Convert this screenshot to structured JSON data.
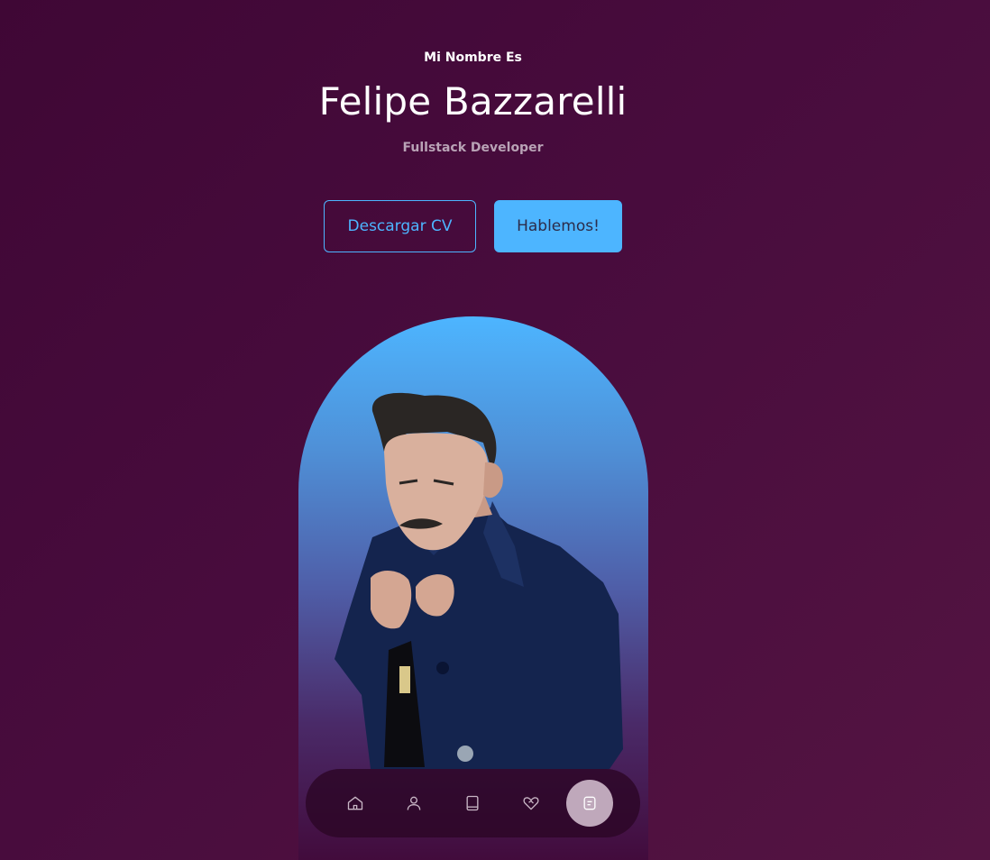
{
  "hero": {
    "greeting": "Mi Nombre Es",
    "name": "Felipe Bazzarelli",
    "role": "Fullstack Developer"
  },
  "cta": {
    "download_cv_label": "Descargar CV",
    "contact_label": "Hablemos!"
  },
  "portrait": {
    "alt": "Felipe Bazzarelli portrait"
  },
  "nav": {
    "items": [
      {
        "icon": "home-icon",
        "active": false
      },
      {
        "icon": "user-icon",
        "active": false
      },
      {
        "icon": "book-icon",
        "active": false
      },
      {
        "icon": "heart-handshake-icon",
        "active": false
      },
      {
        "icon": "message-icon",
        "active": true
      }
    ]
  },
  "colors": {
    "accent": "#4db5ff",
    "background": "#480c3d",
    "muted_text": "#b9a3b6",
    "nav_active": "#bfa8bb"
  }
}
